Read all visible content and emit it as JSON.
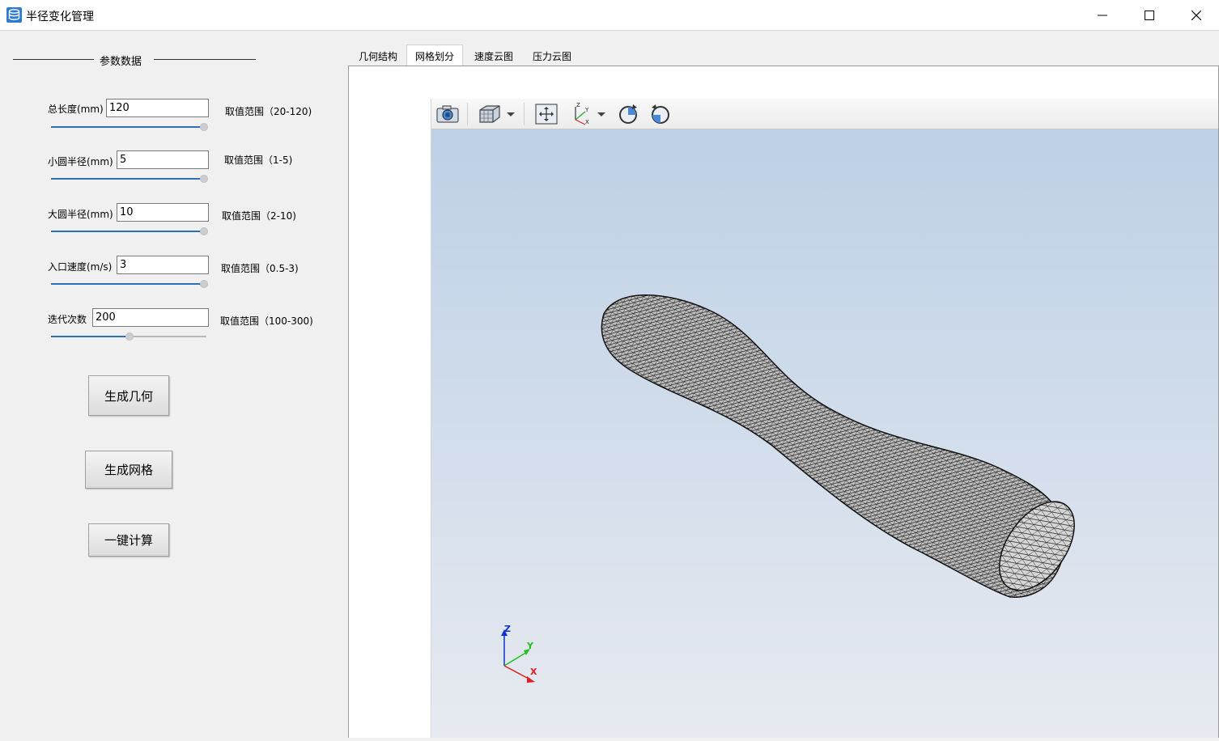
{
  "window": {
    "title": "半径变化管理",
    "icon": "app-database-icon"
  },
  "params": {
    "group_title": "参数数据",
    "items": [
      {
        "label": "总长度(mm)",
        "value": "120",
        "range": "取值范围（20-120)",
        "slider_fraction": 1.0
      },
      {
        "label": "小圆半径(mm)",
        "value": "5",
        "range": "取值范围（1-5)",
        "slider_fraction": 1.0
      },
      {
        "label": "大圆半径(mm)",
        "value": "10",
        "range": "取值范围（2-10)",
        "slider_fraction": 1.0
      },
      {
        "label": "入口速度(m/s)",
        "value": "3",
        "range": "取值范围（0.5-3)",
        "slider_fraction": 1.0
      },
      {
        "label": "迭代次数",
        "value": "200",
        "range": "取值范围（100-300)",
        "slider_fraction": 0.5
      }
    ]
  },
  "buttons": {
    "generate_geometry": "生成几何",
    "generate_mesh": "生成网格",
    "compute": "一键计算"
  },
  "tabs": [
    {
      "label": "几何结构",
      "active": false
    },
    {
      "label": "网格划分",
      "active": true
    },
    {
      "label": "速度云图",
      "active": false
    },
    {
      "label": "压力云图",
      "active": false
    }
  ],
  "viewer": {
    "toolbar_icons": [
      "camera-icon",
      "view-cube-icon",
      "chevron-down-icon",
      "fit-view-icon",
      "axes-icon",
      "chevron-down-icon",
      "rotate-cw-icon",
      "rotate-ccw-icon"
    ],
    "axis_labels": {
      "z": "Z",
      "y": "Y",
      "x": "X"
    },
    "colors": {
      "axis_x": "#e02020",
      "axis_y": "#20c020",
      "axis_z": "#1030d0"
    }
  }
}
